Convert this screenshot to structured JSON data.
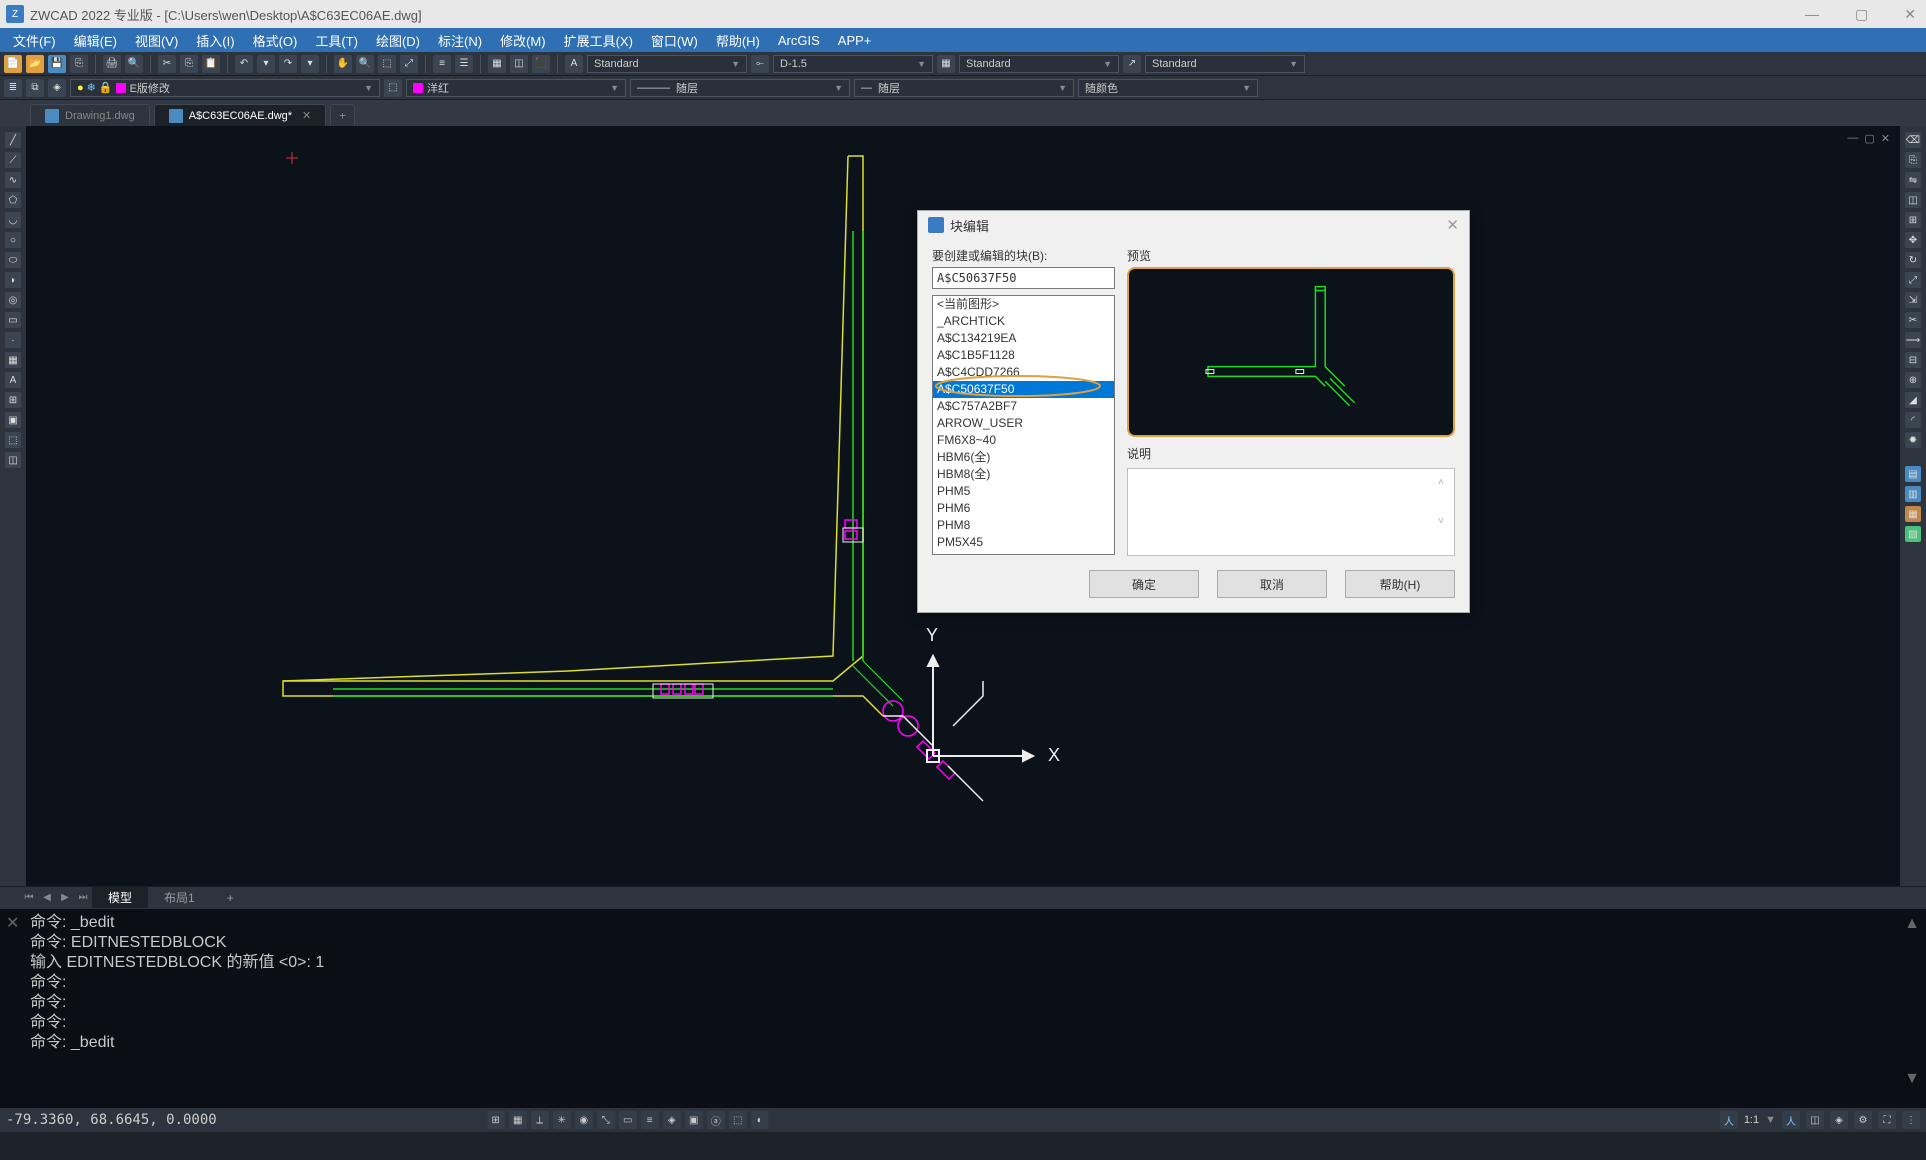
{
  "colors": {
    "accent": "#2f6fb3",
    "canvas_bg": "#0c121a",
    "annotation": "#e0a040"
  },
  "titlebar": {
    "title": "ZWCAD 2022 专业版 - [C:\\Users\\wen\\Desktop\\A$C63EC06AE.dwg]"
  },
  "menubar": [
    "文件(F)",
    "编辑(E)",
    "视图(V)",
    "插入(I)",
    "格式(O)",
    "工具(T)",
    "绘图(D)",
    "标注(N)",
    "修改(M)",
    "扩展工具(X)",
    "窗口(W)",
    "帮助(H)",
    "ArcGIS",
    "APP+"
  ],
  "styles_row": {
    "text_style": "Standard",
    "dim_style": "D-1.5",
    "other_style": "Standard",
    "other_style2": "Standard"
  },
  "layer_row": {
    "layer_name": "E版修改",
    "color_name": "洋红",
    "linetype": "随层",
    "lineweight": "随层",
    "plot_style": "随颜色"
  },
  "file_tabs": [
    {
      "name": "Drawing1.dwg",
      "active": false,
      "modified": false
    },
    {
      "name": "A$C63EC06AE.dwg*",
      "active": true,
      "modified": true
    }
  ],
  "layout_tabs": {
    "model": "模型",
    "layout1": "布局1",
    "add": "+"
  },
  "command_history": [
    "命令: _bedit",
    "命令: EDITNESTEDBLOCK",
    "输入 EDITNESTEDBLOCK 的新值 <0>: 1",
    "命令:",
    "命令:",
    "命令:",
    "命令: _bedit"
  ],
  "axes": {
    "x": "X",
    "y": "Y"
  },
  "status": {
    "coords": "-79.3360, 68.6645, 0.0000",
    "scale": "1:1"
  },
  "dialog": {
    "title": "块编辑",
    "block_label": "要创建或编辑的块(B):",
    "block_value": "A$C50637F50",
    "preview_label": "预览",
    "desc_label": "说明",
    "list": [
      "<当前图形>",
      "_ARCHTICK",
      "A$C134219EA",
      "A$C1B5F1128",
      "A$C4CDD7266",
      "A$C50637F50",
      "A$C757A2BF7",
      "ARROW_USER",
      "FM6X8~40",
      "HBM6(全)",
      "HBM8(全)",
      "PHM5",
      "PHM6",
      "PHM8",
      "PM5X45"
    ],
    "selected_index": 5,
    "btn_ok": "确定",
    "btn_cancel": "取消",
    "btn_help": "帮助(H)"
  }
}
